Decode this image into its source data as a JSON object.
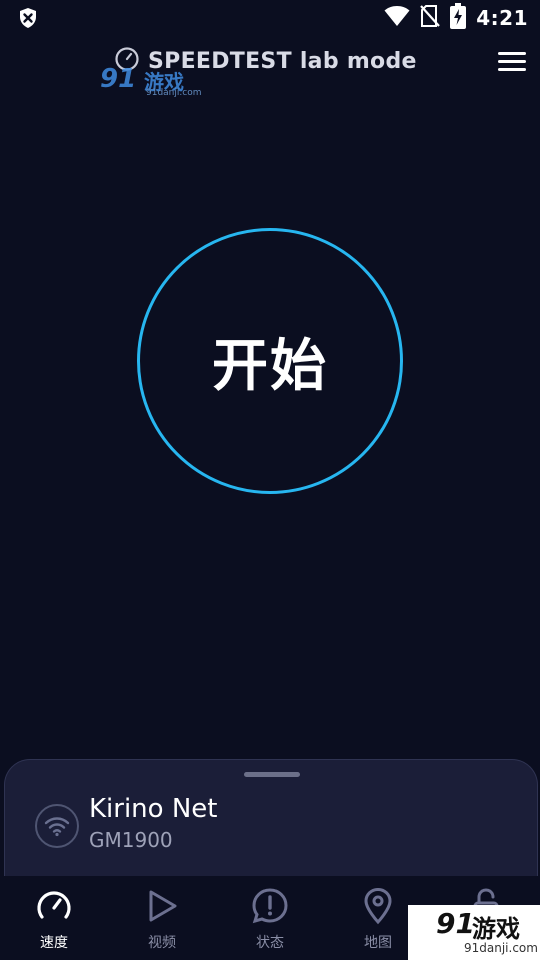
{
  "status_bar": {
    "time": "4:21",
    "icons": [
      "shield-x-icon",
      "wifi-icon",
      "no-sim-icon",
      "battery-charging-icon"
    ]
  },
  "header": {
    "title": "SPEEDTEST lab mode",
    "logo_icon": "speedometer-icon",
    "menu_icon": "hamburger-menu-icon"
  },
  "watermark_top": {
    "brand_number": "91",
    "brand_cn": "游戏",
    "url": "91danji.com"
  },
  "start_button": {
    "label": "开始"
  },
  "network_sheet": {
    "name": "Kirino Net",
    "device": "GM1900",
    "icon": "wifi-icon"
  },
  "bottom_nav": {
    "items": [
      {
        "label": "速度",
        "icon": "speedometer-icon",
        "active": true
      },
      {
        "label": "视频",
        "icon": "play-icon",
        "active": false
      },
      {
        "label": "状态",
        "icon": "alert-bubble-icon",
        "active": false
      },
      {
        "label": "地图",
        "icon": "map-pin-icon",
        "active": false
      },
      {
        "label": "",
        "icon": "unlock-icon",
        "active": false
      }
    ]
  },
  "watermark_bottom": {
    "brand_number": "91",
    "brand_cn": "游戏",
    "url": "91danji.com"
  },
  "colors": {
    "background": "#0b0e20",
    "accent": "#27b6f0",
    "sheet": "#1b1e38",
    "muted_text": "#8a8ea6"
  }
}
